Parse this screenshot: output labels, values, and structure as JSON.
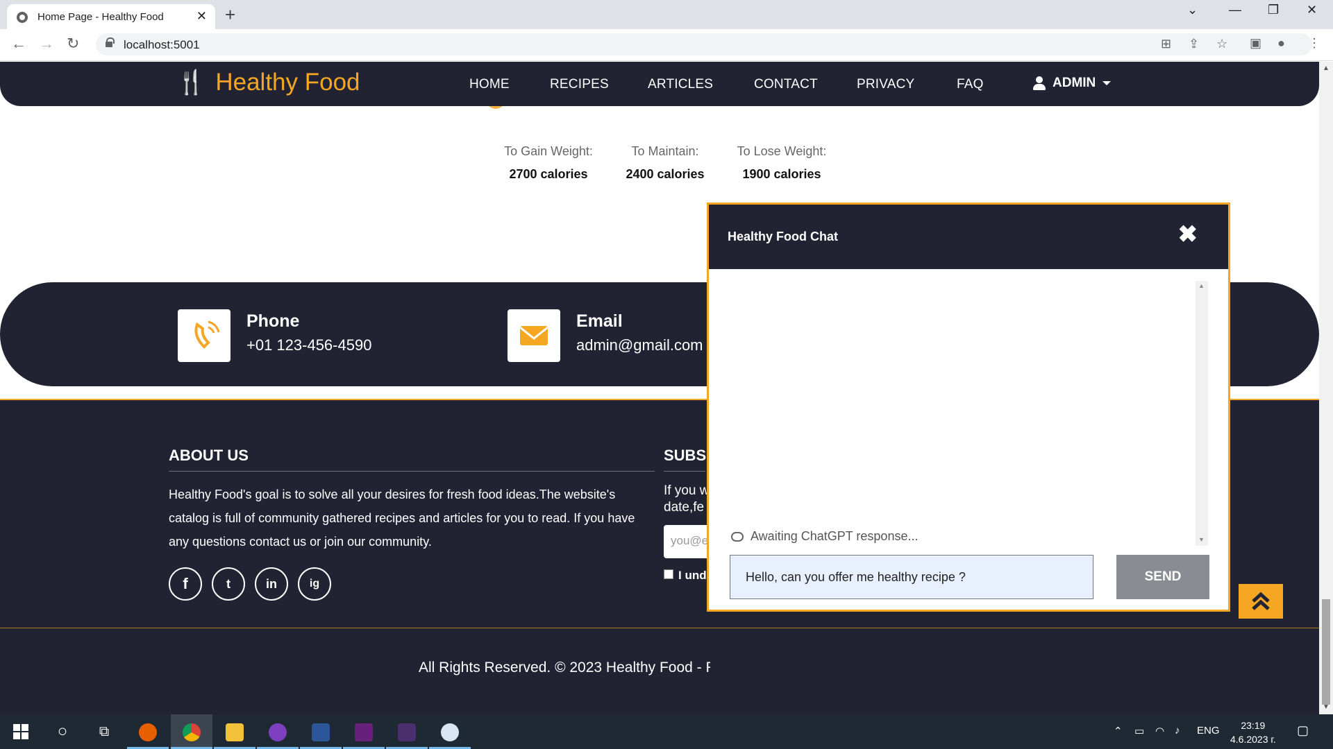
{
  "browser": {
    "tab_title": "Home Page - Healthy Food",
    "url": "localhost:5001"
  },
  "site": {
    "brand": "Healthy Food",
    "nav": [
      "HOME",
      "RECIPES",
      "ARTICLES",
      "CONTACT",
      "PRIVACY",
      "FAQ"
    ],
    "user_menu": "ADMIN"
  },
  "calories": [
    {
      "label": "To Gain Weight:",
      "value": "2700 calories"
    },
    {
      "label": "To Maintain:",
      "value": "2400 calories"
    },
    {
      "label": "To Lose Weight:",
      "value": "1900 calories"
    }
  ],
  "contact": {
    "phone_title": "Phone",
    "phone_value": "+01 123-456-4590",
    "email_title": "Email",
    "email_value": "admin@gmail.com"
  },
  "footer": {
    "about_title": "ABOUT US",
    "about_text": "Healthy Food's goal is to solve all your desires for fresh food ideas.The website's catalog is full of community gathered recipes and articles for you to read. If you have any questions contact us or join our community.",
    "subscribe_title": "SUBSC",
    "subscribe_text_1": "If you w",
    "subscribe_text_2": "date,fe",
    "subscribe_placeholder": "you@e",
    "subscribe_check_label": "I und",
    "social": [
      "f",
      "t",
      "in",
      "ig"
    ],
    "copyright": "All Rights Reserved. © 2023 Healthy Food - F"
  },
  "chat": {
    "title": "Healthy Food Chat",
    "close": "✖",
    "status": "Awaiting ChatGPT response...",
    "input_value": "Hello, can you offer me healthy recipe ?",
    "send_label": "SEND"
  },
  "taskbar": {
    "lang": "ENG",
    "time": "23:19",
    "date": "4.6.2023 г."
  },
  "colors": {
    "accent": "#f5a623",
    "dark": "#212333"
  }
}
